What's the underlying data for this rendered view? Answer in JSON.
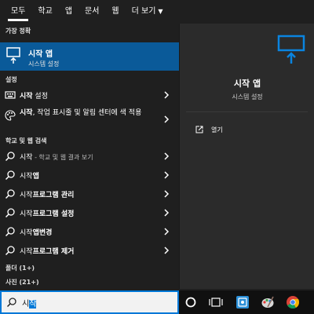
{
  "tabs": [
    {
      "label": "모두",
      "active": true
    },
    {
      "label": "학교"
    },
    {
      "label": "앱"
    },
    {
      "label": "문서"
    },
    {
      "label": "웹"
    },
    {
      "label": "더 보기"
    }
  ],
  "best_match": {
    "header": "가장 정확",
    "title": "시작 앱",
    "subtitle": "시스템 설정"
  },
  "settings": {
    "header": "설정",
    "items": [
      {
        "bold": "시작",
        "rest": " 설정"
      },
      {
        "bold": "시작",
        "rest": ", 작업 표시줄 및 알림 센터에 색 적용"
      }
    ]
  },
  "web": {
    "header": "학교 및 웹 검색",
    "items": [
      {
        "plain": "시작",
        "dim": " - 학교 및 웹 결과 보기"
      },
      {
        "plain": "시작",
        "bold": "앱"
      },
      {
        "plain": "시작",
        "bold": "프로그램 관리"
      },
      {
        "plain": "시작",
        "bold": "프로그램 설정"
      },
      {
        "plain": "시작",
        "bold": "앱변경"
      },
      {
        "plain": "시작",
        "bold": "프로그램 제거"
      }
    ]
  },
  "folders_header": "폴더 (1+)",
  "photos_header": "사진 (21+)",
  "preview": {
    "title": "시작 앱",
    "subtitle": "시스템 설정",
    "open_label": "열기"
  },
  "search": {
    "typed": "시",
    "selected": "작"
  },
  "colors": {
    "accent": "#0078d7",
    "highlight": "#0a5a99"
  }
}
